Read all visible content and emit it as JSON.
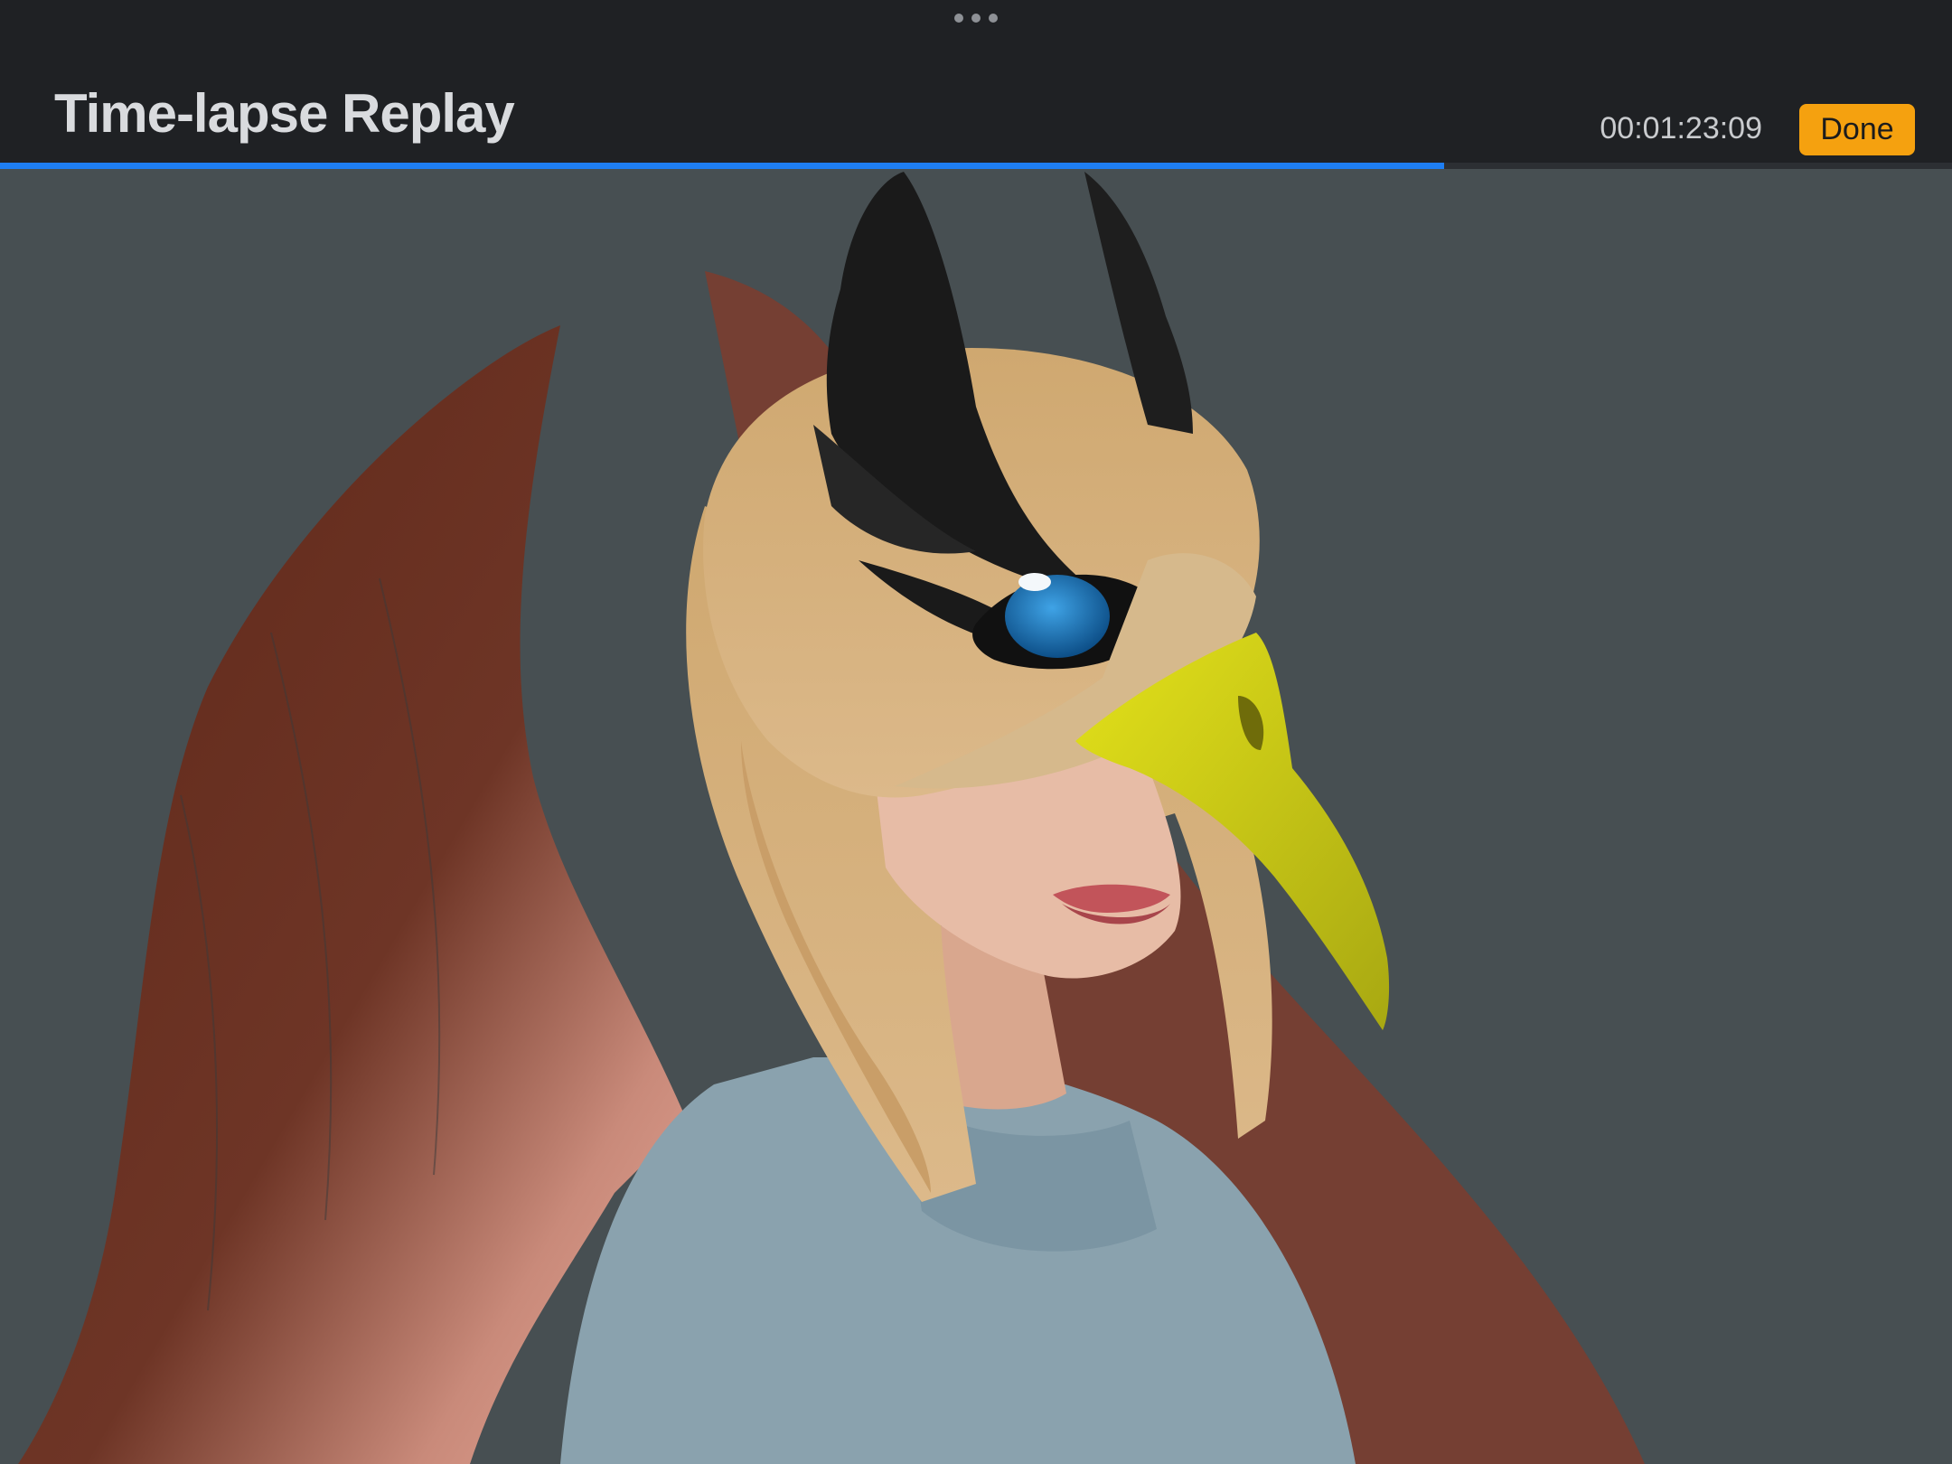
{
  "header": {
    "title": "Time-lapse Replay",
    "timecode": "00:01:23:09",
    "done_label": "Done"
  },
  "progress": {
    "fraction": 0.74
  },
  "colors": {
    "accent": "#1e7ef2",
    "done_button": "#f5a10f",
    "canvas_background": "#474f52"
  },
  "icons": {
    "grabber": "more-dots-icon"
  }
}
